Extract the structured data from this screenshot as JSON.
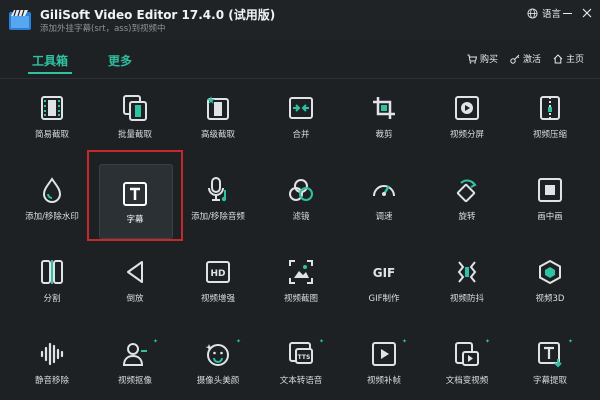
{
  "app": {
    "title": "GiliSoft Video Editor 17.4.0 (试用版)",
    "subtitle": "添加外挂字幕(srt，ass)到视频中"
  },
  "titlebar": {
    "language_label": "语言",
    "minimize_icon": "minimize-icon",
    "close_icon": "close-icon"
  },
  "tabs": [
    {
      "label": "工具箱",
      "active": true
    },
    {
      "label": "更多",
      "active": false
    }
  ],
  "actions": {
    "buy": "购买",
    "activate": "激活",
    "home": "主页"
  },
  "colors": {
    "accent": "#2fc3a3",
    "background": "#1e2124",
    "selection_outline": "#c8282a"
  },
  "tools": [
    {
      "label": "简易截取",
      "icon": "film-simple-cut-icon"
    },
    {
      "label": "批量截取",
      "icon": "batch-cut-icon"
    },
    {
      "label": "高级截取",
      "icon": "advanced-cut-icon"
    },
    {
      "label": "合并",
      "icon": "merge-icon"
    },
    {
      "label": "裁剪",
      "icon": "crop-icon"
    },
    {
      "label": "视频分屏",
      "icon": "split-screen-icon"
    },
    {
      "label": "视频压缩",
      "icon": "compress-icon"
    },
    {
      "label": "添加/移除水印",
      "icon": "watermark-drop-icon"
    },
    {
      "label": "字幕",
      "icon": "subtitle-t-icon",
      "selected": true
    },
    {
      "label": "添加/移除音频",
      "icon": "audio-mic-icon"
    },
    {
      "label": "滤镜",
      "icon": "filter-circles-icon"
    },
    {
      "label": "调速",
      "icon": "speed-gauge-icon"
    },
    {
      "label": "旋转",
      "icon": "rotate-icon"
    },
    {
      "label": "画中画",
      "icon": "picture-in-picture-icon"
    },
    {
      "label": "分割",
      "icon": "split-icon"
    },
    {
      "label": "倒放",
      "icon": "reverse-play-icon"
    },
    {
      "label": "视频增强",
      "icon": "hd-enhance-icon"
    },
    {
      "label": "视频截图",
      "icon": "screenshot-icon"
    },
    {
      "label": "GIF制作",
      "icon": "gif-icon"
    },
    {
      "label": "视频防抖",
      "icon": "stabilize-icon"
    },
    {
      "label": "视频3D",
      "icon": "3d-cube-icon"
    },
    {
      "label": "静音移除",
      "icon": "silence-remove-icon"
    },
    {
      "label": "视频抠像",
      "icon": "matting-person-icon"
    },
    {
      "label": "摄像头美颜",
      "icon": "face-beauty-icon"
    },
    {
      "label": "文本转语音",
      "icon": "text-to-speech-icon"
    },
    {
      "label": "视频补帧",
      "icon": "frame-interpolate-icon"
    },
    {
      "label": "文档变视频",
      "icon": "doc-to-video-icon"
    },
    {
      "label": "字幕提取",
      "icon": "subtitle-extract-icon"
    }
  ]
}
